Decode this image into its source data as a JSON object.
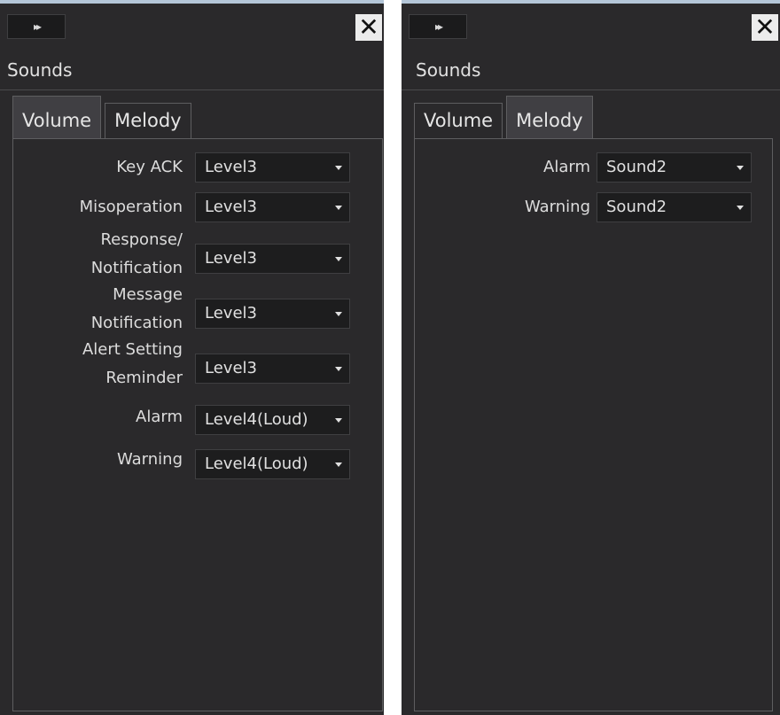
{
  "panels": [
    {
      "expand_label": "▸▸",
      "close_label": "✕",
      "title": "Sounds",
      "tabs": [
        "Volume",
        "Melody"
      ],
      "active_tab": "Volume",
      "rows": [
        {
          "label": "Key ACK",
          "value": "Level3"
        },
        {
          "label": "Misoperation",
          "value": "Level3"
        },
        {
          "label": "Response/",
          "label2": "Notification",
          "value": "Level3"
        },
        {
          "label": "Message",
          "label2": "Notification",
          "value": "Level3"
        },
        {
          "label": "Alert Setting",
          "label2": "Reminder",
          "value": "Level3"
        },
        {
          "label": "Alarm",
          "value": "Level4(Loud)"
        },
        {
          "label": "Warning",
          "value": "Level4(Loud)"
        }
      ]
    },
    {
      "expand_label": "▸▸",
      "close_label": "✕",
      "title": "Sounds",
      "tabs": [
        "Volume",
        "Melody"
      ],
      "active_tab": "Melody",
      "rows": [
        {
          "label": "Alarm",
          "value": "Sound2"
        },
        {
          "label": "Warning",
          "value": "Sound2"
        }
      ]
    }
  ]
}
